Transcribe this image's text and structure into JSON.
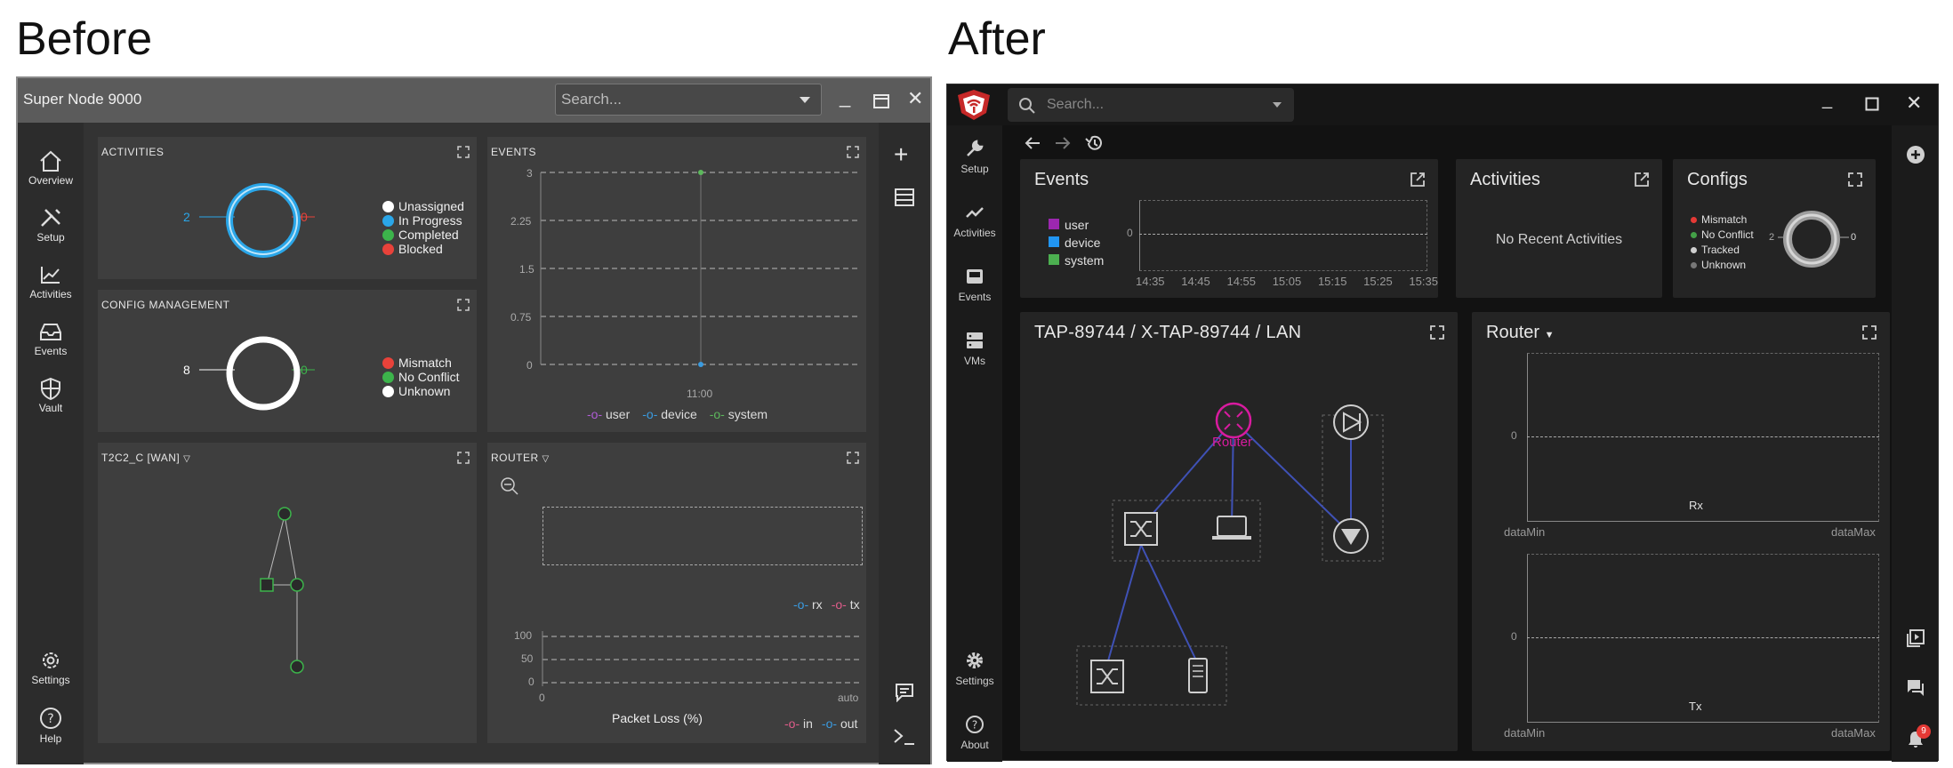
{
  "headings": {
    "before": "Before",
    "after": "After"
  },
  "before": {
    "window_title": "Super Node 9000",
    "search_placeholder": "Search...",
    "nav": [
      {
        "label": "Overview",
        "icon": "home-icon"
      },
      {
        "label": "Setup",
        "icon": "tools-icon"
      },
      {
        "label": "Activities",
        "icon": "chart-line-icon"
      },
      {
        "label": "Events",
        "icon": "inbox-icon"
      },
      {
        "label": "Vault",
        "icon": "shield-icon"
      }
    ],
    "nav_bottom": [
      {
        "label": "Settings",
        "icon": "gear-icon"
      },
      {
        "label": "Help",
        "icon": "help-icon"
      }
    ],
    "activities": {
      "title": "ACTIVITIES",
      "left_value": "2",
      "right_value": "0",
      "legend": [
        {
          "label": "Unassigned",
          "color": "#ffffff"
        },
        {
          "label": "In Progress",
          "color": "#2aa6e8"
        },
        {
          "label": "Completed",
          "color": "#3cb44b"
        },
        {
          "label": "Blocked",
          "color": "#e8423a"
        }
      ]
    },
    "config": {
      "title": "CONFIG MANAGEMENT",
      "left_value": "8",
      "right_value": "0",
      "legend": [
        {
          "label": "Mismatch",
          "color": "#e8423a"
        },
        {
          "label": "No Conflict",
          "color": "#3cb44b"
        },
        {
          "label": "Unknown",
          "color": "#ffffff"
        }
      ]
    },
    "events": {
      "title": "EVENTS",
      "y_ticks": [
        "3",
        "2.25",
        "1.5",
        "0.75",
        "0"
      ],
      "x_tick": "11:00",
      "legend": [
        {
          "label": "user",
          "color": "#b05cd6"
        },
        {
          "label": "device",
          "color": "#3a9be0"
        },
        {
          "label": "system",
          "color": "#5cb85c"
        }
      ]
    },
    "t2c2": {
      "title": "T2C2_C [WAN]"
    },
    "router": {
      "title": "ROUTER",
      "legend_top": [
        {
          "label": "rx",
          "color": "#3a9be0"
        },
        {
          "label": "tx",
          "color": "#e05c8a"
        }
      ],
      "loss_ticks": [
        "100",
        "50",
        "0"
      ],
      "loss_x_left": "0",
      "loss_x_right": "auto",
      "loss_label": "Packet Loss (%)",
      "legend_bottom": [
        {
          "label": "in",
          "color": "#e05c8a"
        },
        {
          "label": "out",
          "color": "#3a9be0"
        }
      ]
    }
  },
  "after": {
    "search_placeholder": "Search...",
    "nav": [
      {
        "label": "Setup",
        "icon": "wrench-icon"
      },
      {
        "label": "Activities",
        "icon": "chart-line-icon"
      },
      {
        "label": "Events",
        "icon": "inbox-icon"
      },
      {
        "label": "VMs",
        "icon": "server-icon"
      }
    ],
    "nav_bottom": [
      {
        "label": "Settings",
        "icon": "gear-icon"
      },
      {
        "label": "About",
        "icon": "help-icon"
      }
    ],
    "events": {
      "title": "Events",
      "legend": [
        {
          "label": "user",
          "color": "#9c27b0"
        },
        {
          "label": "device",
          "color": "#2196f3"
        },
        {
          "label": "system",
          "color": "#4caf50"
        }
      ],
      "y_tick": "0",
      "x_ticks": [
        "14:35",
        "14:45",
        "14:55",
        "15:05",
        "15:15",
        "15:25",
        "15:35"
      ]
    },
    "activities": {
      "title": "Activities",
      "empty_text": "No Recent Activities"
    },
    "configs": {
      "title": "Configs",
      "legend": [
        {
          "label": "Mismatch",
          "color": "#e53935"
        },
        {
          "label": "No Conflict",
          "color": "#43a047"
        },
        {
          "label": "Tracked",
          "color": "#cfcfcf"
        },
        {
          "label": "Unknown",
          "color": "#777777"
        }
      ],
      "left_value": "2",
      "right_value": "0"
    },
    "topology": {
      "breadcrumb": "TAP-89744 / X-TAP-89744 / LAN",
      "router_label": "Router"
    },
    "router": {
      "title": "Router",
      "rx": {
        "y_tick": "0",
        "label": "Rx",
        "x_min": "dataMin",
        "x_max": "dataMax"
      },
      "tx": {
        "y_tick": "0",
        "label": "Tx",
        "x_min": "dataMin",
        "x_max": "dataMax"
      }
    },
    "notification_count": "9"
  }
}
